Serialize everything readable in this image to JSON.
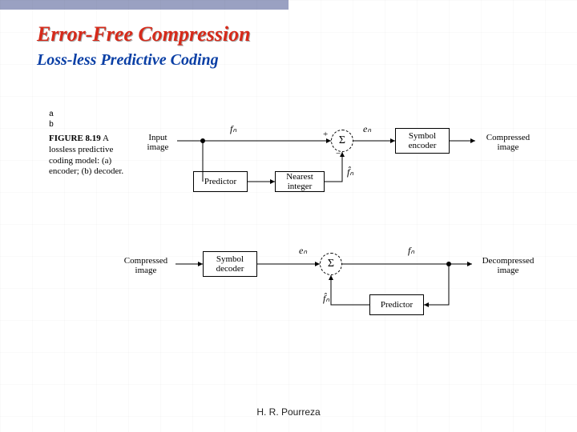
{
  "header": {
    "title": "Error-Free Compression",
    "subtitle": "Loss-less Predictive Coding"
  },
  "footer": {
    "author": "H. R. Pourreza"
  },
  "figure": {
    "markers": {
      "a": "a",
      "b": "b"
    },
    "caption_label": "FIGURE 8.19",
    "caption_text": "A lossless predictive coding model: (a) encoder; (b) decoder.",
    "encoder": {
      "input_label": "Input image",
      "fn": "fₙ",
      "summation": "Σ",
      "sign_plus": "+",
      "sign_minus": "−",
      "en": "eₙ",
      "symbol_encoder": "Symbol encoder",
      "output_label": "Compressed image",
      "predictor": "Predictor",
      "nearest_integer": "Nearest integer",
      "fhat": "f̂ₙ"
    },
    "decoder": {
      "input_label": "Compressed image",
      "symbol_decoder": "Symbol decoder",
      "en": "eₙ",
      "summation": "Σ",
      "fn_out": "fₙ",
      "output_label": "Decompressed image",
      "predictor": "Predictor",
      "fhat": "f̂ₙ"
    }
  }
}
